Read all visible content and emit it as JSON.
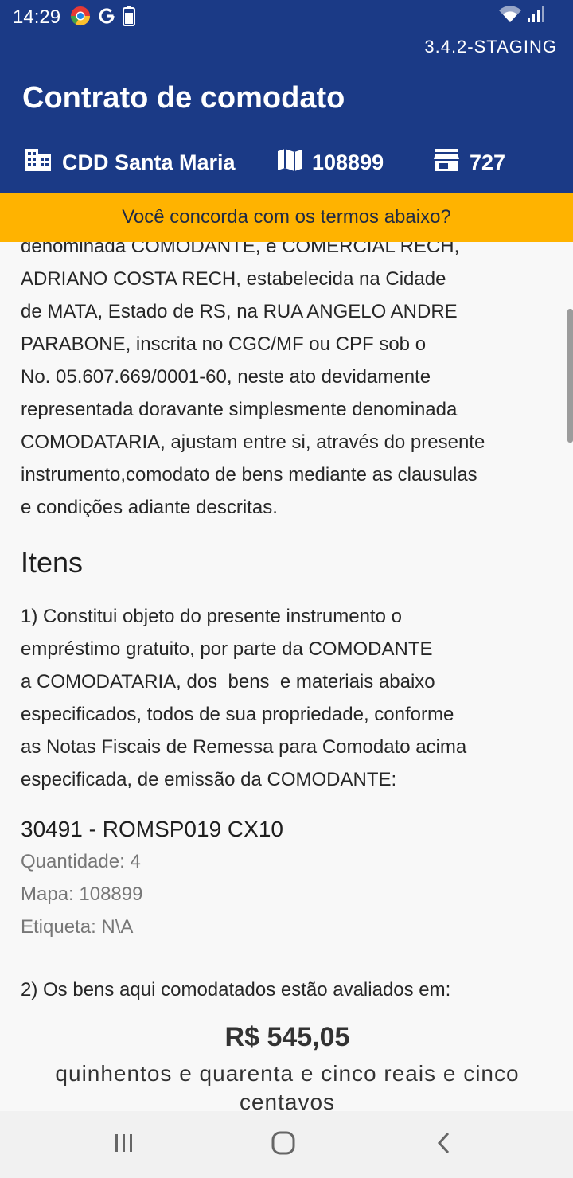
{
  "status_bar": {
    "time": "14:29",
    "battery_label": "100",
    "icons": [
      "chrome-icon",
      "google-g-icon",
      "battery-icon",
      "wifi-icon",
      "signal-icon"
    ]
  },
  "header": {
    "version": "3.4.2-STAGING",
    "title": "Contrato de comodato",
    "info": {
      "distribution_center": "CDD Santa Maria",
      "map_number": "108899",
      "store_number": "727"
    }
  },
  "banner": {
    "question": "Você concorda com os termos abaixo?"
  },
  "contract": {
    "intro_lines": [
      "denominada COMODANTE, e COMERCIAL RECH,",
      "ADRIANO COSTA RECH, estabelecida na Cidade",
      "de MATA, Estado de RS, na RUA ANGELO ANDRE",
      "PARABONE, inscrita no CGC/MF ou CPF sob o",
      "No. 05.607.669/0001-60, neste ato devidamente",
      "representada doravante simplesmente denominada",
      "COMODATARIA, ajustam entre si, através do presente",
      "instrumento,comodato de bens mediante as clausulas",
      "e condições adiante descritas."
    ],
    "items_title": "Itens",
    "clause1_lines": [
      "1) Constitui objeto do presente instrumento o",
      "empréstimo gratuito, por parte da COMODANTE",
      "a COMODATARIA, dos  bens  e materiais abaixo",
      "especificados, todos de sua propriedade, conforme",
      "as Notas Fiscais de Remessa para Comodato acima",
      "especificada, de emissão da COMODANTE:"
    ],
    "item": {
      "code": "30491 - ROMSP019 CX10",
      "quantity": "Quantidade: 4",
      "map": "Mapa: 108899",
      "tag": "Etiqueta: N\\A"
    },
    "clause2": "2) Os bens aqui comodatados estão avaliados em:",
    "value": "R$ 545,05",
    "value_words_line1": "quinhentos e quarenta e cinco reais e cinco",
    "value_words_line2": "centavos"
  },
  "nav": {
    "icons": [
      "recent-apps-icon",
      "home-icon",
      "back-icon"
    ]
  },
  "colors": {
    "header_bg": "#1b3a86",
    "banner_bg": "#ffb300",
    "text": "#262626",
    "muted_text": "#777777"
  }
}
